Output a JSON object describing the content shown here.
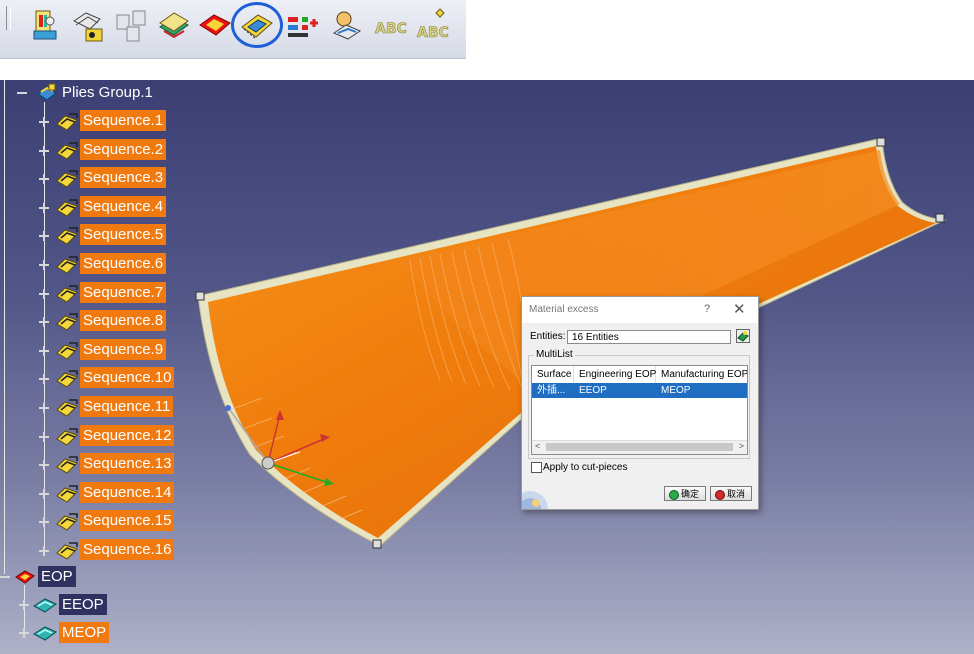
{
  "toolbar": {
    "icons": [
      "create-plies-icon",
      "material-excess-sequence-icon",
      "plies-exploder-icon",
      "stacking-icon",
      "eop-icon",
      "material-excess-icon",
      "ply-table-icon",
      "producibility-icon",
      "abc-text-icon",
      "abc-text-alt-icon"
    ],
    "active_icon": "material-excess-icon"
  },
  "tree": {
    "root": {
      "label": "Plies Group.1",
      "icon": "plies-group-icon"
    },
    "sequences": [
      "Sequence.1",
      "Sequence.2",
      "Sequence.3",
      "Sequence.4",
      "Sequence.5",
      "Sequence.6",
      "Sequence.7",
      "Sequence.8",
      "Sequence.9",
      "Sequence.10",
      "Sequence.11",
      "Sequence.12",
      "Sequence.13",
      "Sequence.14",
      "Sequence.15",
      "Sequence.16"
    ],
    "eop": {
      "label": "EOP",
      "icon": "eop-icon"
    },
    "eop_children": [
      {
        "label": "EEOP",
        "selected": false
      },
      {
        "label": "MEOP",
        "selected": true
      }
    ]
  },
  "dialog": {
    "title": "Material excess",
    "help": "?",
    "close": "✕",
    "entities_label": "Entities:",
    "entities_value": "16 Entities",
    "multilist_label": "MultiList",
    "columns": [
      "Surface",
      "Engineering EOP",
      "Manufacturing EOP"
    ],
    "rows": [
      [
        "外插...",
        "EEOP",
        "MEOP"
      ]
    ],
    "scroll_left": "<",
    "scroll_right": ">",
    "apply_checkbox_label": "Apply to cut-pieces",
    "apply_checked": false,
    "ok_label": "确定",
    "cancel_label": "取消"
  },
  "colors": {
    "selection": "#f07a10",
    "viewport_top": "#3c3f73",
    "viewport_bottom": "#aeb1c8",
    "part_orange": "#f08010",
    "list_selection": "#1f6ec2"
  }
}
